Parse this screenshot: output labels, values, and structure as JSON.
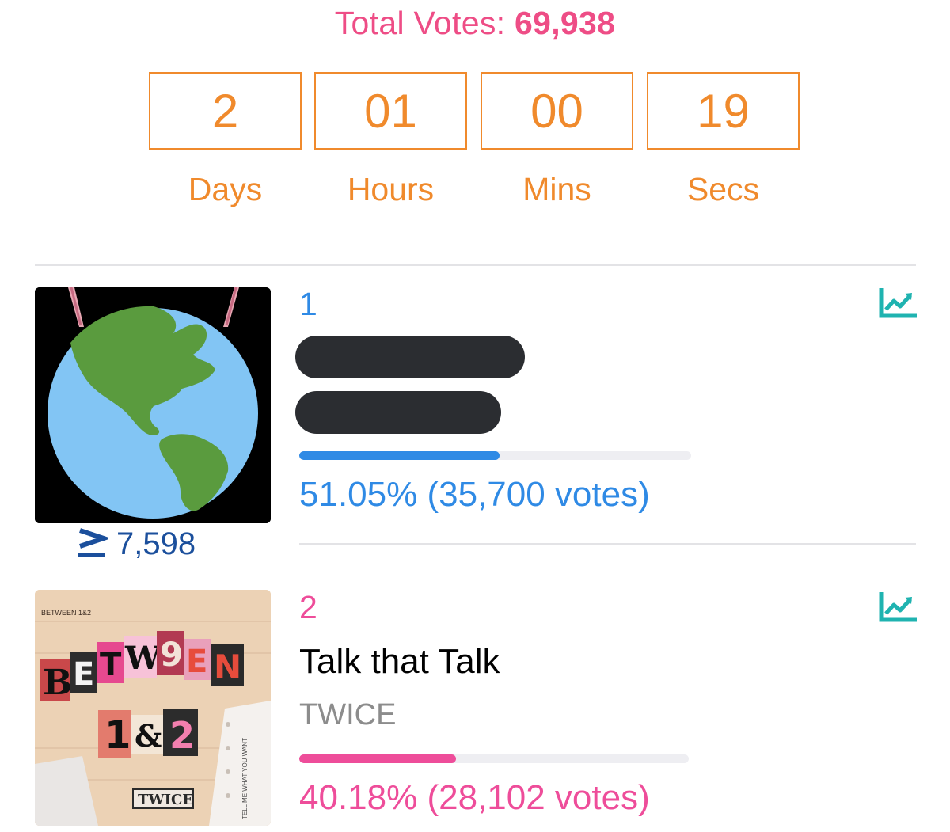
{
  "header": {
    "total_votes_label": "Total Votes:",
    "total_votes_value": "69,938"
  },
  "countdown": {
    "days": "2",
    "hours": "01",
    "mins": "00",
    "secs": "19",
    "days_label": "Days",
    "hours_label": "Hours",
    "mins_label": "Mins",
    "secs_label": "Secs"
  },
  "entries": [
    {
      "rank": "1",
      "title_redacted": true,
      "percent": 51.05,
      "percent_text": "51.05% (35,700 votes)",
      "rank_change": "7,598",
      "color": "#2f8ae5",
      "icon": "chart-trend-icon"
    },
    {
      "rank": "2",
      "title": "Talk that Talk",
      "artist": "TWICE",
      "percent": 40.18,
      "percent_text": "40.18% (28,102 votes)",
      "color": "#ee4d9a",
      "icon": "chart-trend-icon"
    }
  ],
  "album_art": {
    "album_text": "BETW9EN",
    "sub_text": "1&2",
    "artist_stamp": "TWICE",
    "small_caption": "BETWEEN 1&2",
    "side_text": "TELL ME WHAT YOU WANT"
  },
  "colors": {
    "accent_pink": "#ee4d86",
    "countdown_orange": "#f08a2c",
    "rank1_blue": "#2f8ae5",
    "rank2_pink": "#ee4d9a",
    "trend_icon_teal": "#1fb3b0",
    "rank_change_blue": "#1b4f9c"
  }
}
